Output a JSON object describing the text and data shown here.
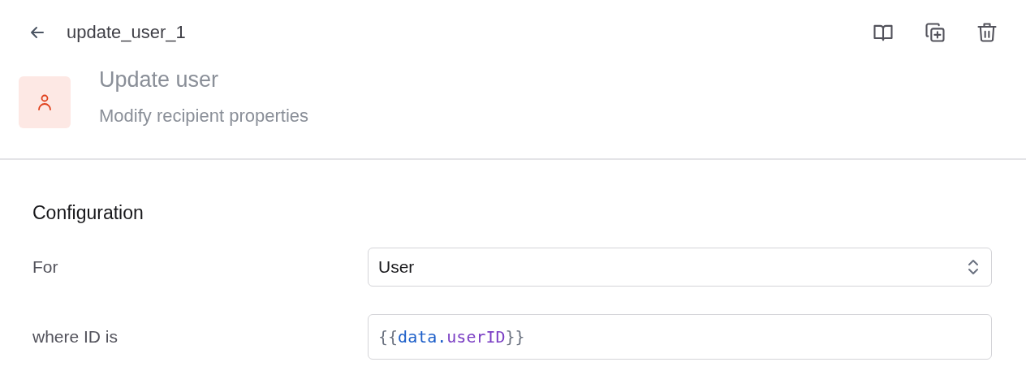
{
  "header": {
    "title": "update_user_1"
  },
  "step": {
    "title": "Update user",
    "description": "Modify recipient properties"
  },
  "configuration": {
    "heading": "Configuration",
    "fields": [
      {
        "label": "For",
        "kind": "select",
        "value": "User"
      },
      {
        "label": "where ID is",
        "kind": "code",
        "tokens": [
          {
            "text": "{{",
            "kind": "brace"
          },
          {
            "text": "data",
            "kind": "object"
          },
          {
            "text": ".",
            "kind": "dot"
          },
          {
            "text": "userID",
            "kind": "property"
          },
          {
            "text": "}}",
            "kind": "brace"
          }
        ]
      }
    ]
  }
}
